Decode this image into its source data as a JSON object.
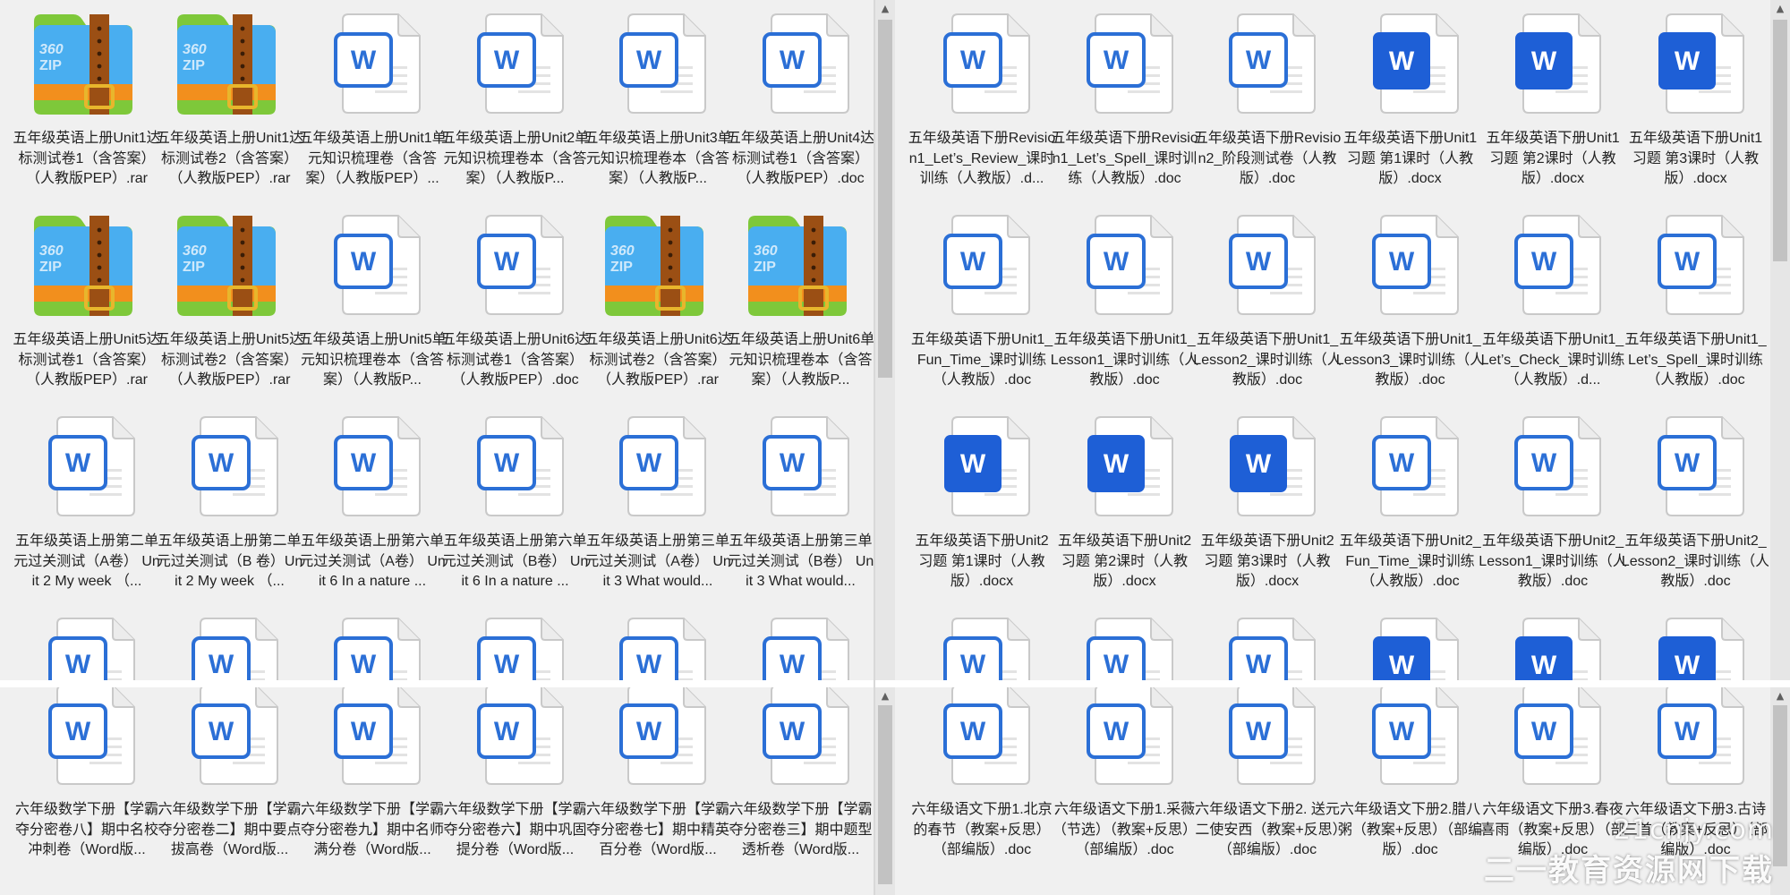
{
  "icon_labels": {
    "word": "W",
    "zip_top": "360",
    "zip_bottom": "ZIP"
  },
  "colors": {
    "word_light": "#2b6fd6",
    "word_dark": "#1e5fd6",
    "zip_blue": "#49aef0",
    "zip_orange": "#f28f1d",
    "zip_green": "#7ec83a",
    "zip_strap": "#9b4f14"
  },
  "panes": [
    {
      "name": "top-left-pane",
      "items": [
        {
          "icon": "zip",
          "label": "五年级英语上册Unit1达标测试卷1（含答案）（人教版PEP）.rar"
        },
        {
          "icon": "zip",
          "label": "五年级英语上册Unit1达标测试卷2（含答案）（人教版PEP）.rar"
        },
        {
          "icon": "word",
          "label": "五年级英语上册Unit1单元知识梳理卷（含答案）（人教版PEP）..."
        },
        {
          "icon": "word",
          "label": "五年级英语上册Unit2单元知识梳理卷本（含答案）（人教版P..."
        },
        {
          "icon": "word",
          "label": "五年级英语上册Unit3单元知识梳理卷本（含答案）（人教版P..."
        },
        {
          "icon": "word",
          "label": "五年级英语上册Unit4达标测试卷1（含答案）（人教版PEP）.doc"
        },
        {
          "icon": "zip",
          "label": "五年级英语上册Unit5达标测试卷1（含答案）（人教版PEP）.rar"
        },
        {
          "icon": "zip",
          "label": "五年级英语上册Unit5达标测试卷2（含答案）（人教版PEP）.rar"
        },
        {
          "icon": "word",
          "label": "五年级英语上册Unit5单元知识梳理卷本（含答案）（人教版P..."
        },
        {
          "icon": "word",
          "label": "五年级英语上册Unit6达标测试卷1（含答案）（人教版PEP）.doc"
        },
        {
          "icon": "zip",
          "label": "五年级英语上册Unit6达标测试卷2（含答案）（人教版PEP）.rar"
        },
        {
          "icon": "zip",
          "label": "五年级英语上册Unit6单元知识梳理卷本（含答案）（人教版P..."
        },
        {
          "icon": "word",
          "label": "五年级英语上册第二单元过关测试（A卷） Unit 2 My week （..."
        },
        {
          "icon": "word",
          "label": "五年级英语上册第二单元过关测试（B 卷）Unit 2 My week （..."
        },
        {
          "icon": "word",
          "label": "五年级英语上册第六单元过关测试（A卷） Unit 6 In a nature ..."
        },
        {
          "icon": "word",
          "label": "五年级英语上册第六单元过关测试（B卷） Unit 6 In a nature ..."
        },
        {
          "icon": "word",
          "label": "五年级英语上册第三单元过关测试（A卷） Unit 3 What would..."
        },
        {
          "icon": "word",
          "label": "五年级英语上册第三单元过关测试（B卷） Unit 3 What would..."
        },
        {
          "icon": "word",
          "label": ""
        },
        {
          "icon": "word",
          "label": ""
        },
        {
          "icon": "word",
          "label": ""
        },
        {
          "icon": "word",
          "label": ""
        },
        {
          "icon": "word",
          "label": ""
        },
        {
          "icon": "word",
          "label": ""
        }
      ]
    },
    {
      "name": "top-right-pane",
      "items": [
        {
          "icon": "word",
          "label": "五年级英语下册Revision1_Let’s_Review_课时训练（人教版）.d..."
        },
        {
          "icon": "word",
          "label": "五年级英语下册Revision1_Let’s_Spell_课时训练（人教版）.doc"
        },
        {
          "icon": "word",
          "label": "五年级英语下册Revision2_阶段测试卷（人教版）.doc"
        },
        {
          "icon": "worddark",
          "label": "五年级英语下册Unit1 习题 第1课时（人教版）.docx"
        },
        {
          "icon": "worddark",
          "label": "五年级英语下册Unit1 习题 第2课时（人教版）.docx"
        },
        {
          "icon": "worddark",
          "label": "五年级英语下册Unit1 习题 第3课时（人教版）.docx"
        },
        {
          "icon": "word",
          "label": "五年级英语下册Unit1_Fun_Time_课时训练（人教版）.doc"
        },
        {
          "icon": "word",
          "label": "五年级英语下册Unit1_Lesson1_课时训练（人教版）.doc"
        },
        {
          "icon": "word",
          "label": "五年级英语下册Unit1_Lesson2_课时训练（人教版）.doc"
        },
        {
          "icon": "word",
          "label": "五年级英语下册Unit1_Lesson3_课时训练（人教版）.doc"
        },
        {
          "icon": "word",
          "label": "五年级英语下册Unit1_Let’s_Check_课时训练（人教版）.d..."
        },
        {
          "icon": "word",
          "label": "五年级英语下册Unit1_Let’s_Spell_课时训练（人教版）.doc"
        },
        {
          "icon": "worddark",
          "label": "五年级英语下册Unit2 习题 第1课时（人教版）.docx"
        },
        {
          "icon": "worddark",
          "label": "五年级英语下册Unit2 习题 第2课时（人教版）.docx"
        },
        {
          "icon": "worddark",
          "label": "五年级英语下册Unit2 习题 第3课时（人教版）.docx"
        },
        {
          "icon": "word",
          "label": "五年级英语下册Unit2_Fun_Time_课时训练（人教版）.doc"
        },
        {
          "icon": "word",
          "label": "五年级英语下册Unit2_Lesson1_课时训练（人教版）.doc"
        },
        {
          "icon": "word",
          "label": "五年级英语下册Unit2_Lesson2_课时训练（人教版）.doc"
        },
        {
          "icon": "word",
          "label": ""
        },
        {
          "icon": "word",
          "label": ""
        },
        {
          "icon": "word",
          "label": ""
        },
        {
          "icon": "worddark",
          "label": ""
        },
        {
          "icon": "worddark",
          "label": ""
        },
        {
          "icon": "worddark",
          "label": ""
        }
      ]
    },
    {
      "name": "bottom-left-pane",
      "items": [
        {
          "icon": "word",
          "label": "六年级数学下册【学霸夺分密卷八】期中名校冲刺卷（Word版..."
        },
        {
          "icon": "word",
          "label": "六年级数学下册【学霸夺分密卷二】期中要点拔高卷（Word版..."
        },
        {
          "icon": "word",
          "label": "六年级数学下册【学霸夺分密卷九】期中名师满分卷（Word版..."
        },
        {
          "icon": "word",
          "label": "六年级数学下册【学霸夺分密卷六】期中巩固提分卷（Word版..."
        },
        {
          "icon": "word",
          "label": "六年级数学下册【学霸夺分密卷七】期中精英百分卷（Word版..."
        },
        {
          "icon": "word",
          "label": "六年级数学下册【学霸夺分密卷三】期中题型透析卷（Word版..."
        }
      ]
    },
    {
      "name": "bottom-right-pane",
      "items": [
        {
          "icon": "word",
          "label": "六年级语文下册1.北京的春节（教案+反思）（部编版）.doc"
        },
        {
          "icon": "word",
          "label": "六年级语文下册1.采薇（节选）（教案+反思）（部编版）.doc"
        },
        {
          "icon": "word",
          "label": "六年级语文下册2. 送元二使安西（教案+反思）（部编版）.doc"
        },
        {
          "icon": "word",
          "label": "六年级语文下册2.腊八粥（教案+反思）（部编版）.doc"
        },
        {
          "icon": "word",
          "label": "六年级语文下册3.春夜喜雨（教案+反思）（部编版）.doc"
        },
        {
          "icon": "word",
          "label": "六年级语文下册3.古诗三首（教案+反思）（部编版）.doc"
        }
      ]
    }
  ],
  "watermark": {
    "line1": "21cnjy.com",
    "line2": "二一教育资源网下载"
  }
}
